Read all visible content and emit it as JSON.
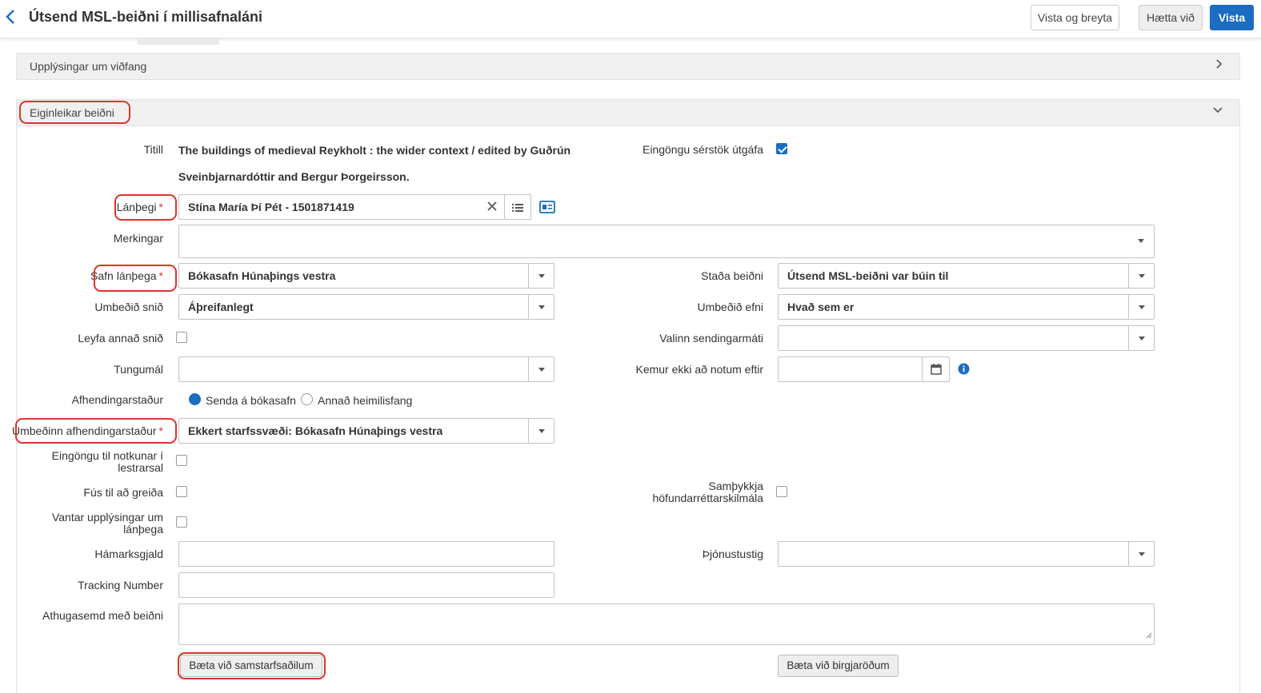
{
  "header": {
    "title": "Útsend MSL-beiðni í millisafnaláni",
    "buttons": {
      "save_and_edit": "Vista og breyta",
      "cancel": "Hætta við",
      "save": "Vista"
    }
  },
  "sections": {
    "address_info": {
      "label": "Upplýsingar um viðfang"
    },
    "request_attributes": {
      "label": "Eiginleikar beiðni"
    }
  },
  "form": {
    "title": {
      "label": "Titill",
      "line1": "The buildings of medieval Reykholt : the wider context / edited by Guðrún",
      "line2": "Sveinbjarnardóttir and Bergur Þorgeirsson."
    },
    "specific_edition": {
      "label": "Eingöngu sérstök útgáfa",
      "checked": true
    },
    "borrower": {
      "label": "Lánþegi",
      "required": "*",
      "value": "Stína María Þí Pét  - 1501871419"
    },
    "notes": {
      "label": "Merkingar",
      "value": ""
    },
    "borrower_library": {
      "label": "Safn lánþega",
      "required": "*",
      "value": "Bókasafn Húnaþings vestra"
    },
    "request_status": {
      "label": "Staða beiðni",
      "value": "Útsend MSL-beiðni var búin til"
    },
    "requested_format": {
      "label": "Umbeðið snið",
      "value": "Áþreifanlegt"
    },
    "requested_material": {
      "label": "Umbeðið efni",
      "value": "Hvað sem er"
    },
    "allow_other_format": {
      "label": "Leyfa annað snið",
      "checked": false
    },
    "delivery_method": {
      "label": "Valinn sendingarmáti",
      "value": ""
    },
    "language": {
      "label": "Tungumál",
      "value": ""
    },
    "not_needed_after": {
      "label": "Kemur ekki að notum eftir",
      "value": ""
    },
    "delivery_location": {
      "label": "Afhendingarstaður",
      "options": [
        "Senda á bókasafn",
        "Annað heimilisfang"
      ],
      "selected": "Senda á bókasafn"
    },
    "requested_delivery_location": {
      "label": "Umbeðinn afhendingarstaður",
      "required": "*",
      "value": "Ekkert starfssvæði: Bókasafn Húnaþings vestra"
    },
    "reading_room_only": {
      "label_line1": "Eingöngu til notkunar í",
      "label_line2": "lestrarsal",
      "checked": false
    },
    "willing_to_pay": {
      "label": "Fús til að greiða",
      "checked": false
    },
    "copyright_agree": {
      "label_line1": "Samþykkja",
      "label_line2": "höfundarréttarskilmála",
      "checked": false
    },
    "missing_borrower_info": {
      "label_line1": "Vantar upplýsingar um",
      "label_line2": "lánþega",
      "checked": false
    },
    "max_fee": {
      "label": "Hámarksgjald",
      "value": ""
    },
    "service_level": {
      "label": "Þjónustustig",
      "value": ""
    },
    "tracking_number": {
      "label": "Tracking Number",
      "value": ""
    },
    "request_note": {
      "label": "Athugasemd með beiðni",
      "value": ""
    },
    "buttons": {
      "add_partner": "Bæta við samstarfsaðilum",
      "add_suppliers": "Bæta við birgjaröðum"
    }
  },
  "colors": {
    "accent": "#1b6dc1",
    "highlight": "#d9352b",
    "required": "#d9352b"
  },
  "icons": [
    "chevron-left-icon",
    "chevron-right-icon",
    "chevron-down-icon",
    "clear-x-icon",
    "list-icon",
    "id-card-icon",
    "calendar-icon",
    "info-icon"
  ]
}
